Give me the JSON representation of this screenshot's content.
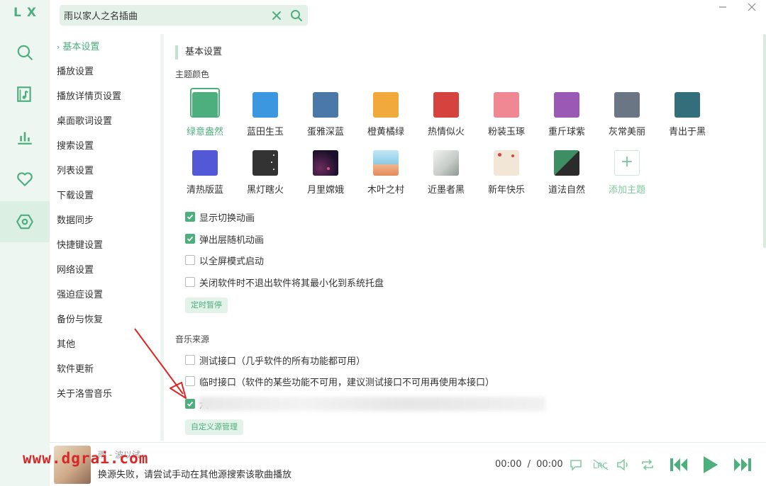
{
  "app": {
    "logo": "LX"
  },
  "search": {
    "value": "雨以家人之名插曲"
  },
  "nav": {
    "items": [
      {
        "label": "基本设置",
        "active": true
      },
      {
        "label": "播放设置"
      },
      {
        "label": "播放详情页设置"
      },
      {
        "label": "桌面歌词设置"
      },
      {
        "label": "搜索设置"
      },
      {
        "label": "列表设置"
      },
      {
        "label": "下载设置"
      },
      {
        "label": "数据同步"
      },
      {
        "label": "快捷键设置"
      },
      {
        "label": "网络设置"
      },
      {
        "label": "强迫症设置"
      },
      {
        "label": "备份与恢复"
      },
      {
        "label": "其他"
      },
      {
        "label": "软件更新"
      },
      {
        "label": "关于洛雪音乐"
      }
    ]
  },
  "basic": {
    "title": "基本设置",
    "theme_label": "主题颜色",
    "themes": [
      {
        "name": "绿意盎然",
        "color": "#4caf7d",
        "active": true
      },
      {
        "name": "蓝田生玉",
        "color": "#3b98e0"
      },
      {
        "name": "蛋雅深蓝",
        "color": "#4a78a8"
      },
      {
        "name": "橙黄橘绿",
        "color": "#f2a93b"
      },
      {
        "name": "热情似火",
        "color": "#d6433f"
      },
      {
        "name": "粉装玉琢",
        "color": "#ef8892"
      },
      {
        "name": "重斤球紫",
        "color": "#9b59b6"
      },
      {
        "name": "灰常美丽",
        "color": "#6b7685"
      },
      {
        "name": "青出于黑",
        "color": "#326f7b"
      },
      {
        "name": "清热版蓝",
        "color": "#5359d6"
      },
      {
        "name": "黑灯瞎火",
        "color": "#333333"
      },
      {
        "name": "月里嫦娥",
        "color": "#1b1029"
      },
      {
        "name": "木叶之村",
        "color": "#8ecae6"
      },
      {
        "name": "近墨者黑",
        "color": "#c8cdc9"
      },
      {
        "name": "新年快乐",
        "color": "#f2e6d6"
      },
      {
        "name": "道法自然",
        "color": "#3d8f63"
      },
      {
        "name": "添加主题",
        "add": true
      }
    ],
    "options": [
      {
        "label": "显示切换动画",
        "checked": true
      },
      {
        "label": "弹出层随机动画",
        "checked": true
      },
      {
        "label": "以全屏模式启动",
        "checked": false
      },
      {
        "label": "关闭软件时不退出软件将其最小化到系统托盘",
        "checked": false
      }
    ],
    "timer_button": "定时暂停",
    "source_label": "音乐来源",
    "sources": [
      {
        "label": "测试接口（几乎软件的所有功能都可用）",
        "checked": false
      },
      {
        "label": "临时接口（软件的某些功能不可用，建议测试接口不可用再使用本接口）",
        "checked": false
      },
      {
        "label": "六",
        "checked": true
      }
    ],
    "custom_source_button": "自定义源管理"
  },
  "player": {
    "song": "雨 - 波以试",
    "status": "换源失败，请尝试手动在其他源搜索该歌曲播放",
    "current_time": "00:00",
    "separator": "/",
    "total_time": "00:00"
  },
  "watermark": "www.dgrai.com"
}
